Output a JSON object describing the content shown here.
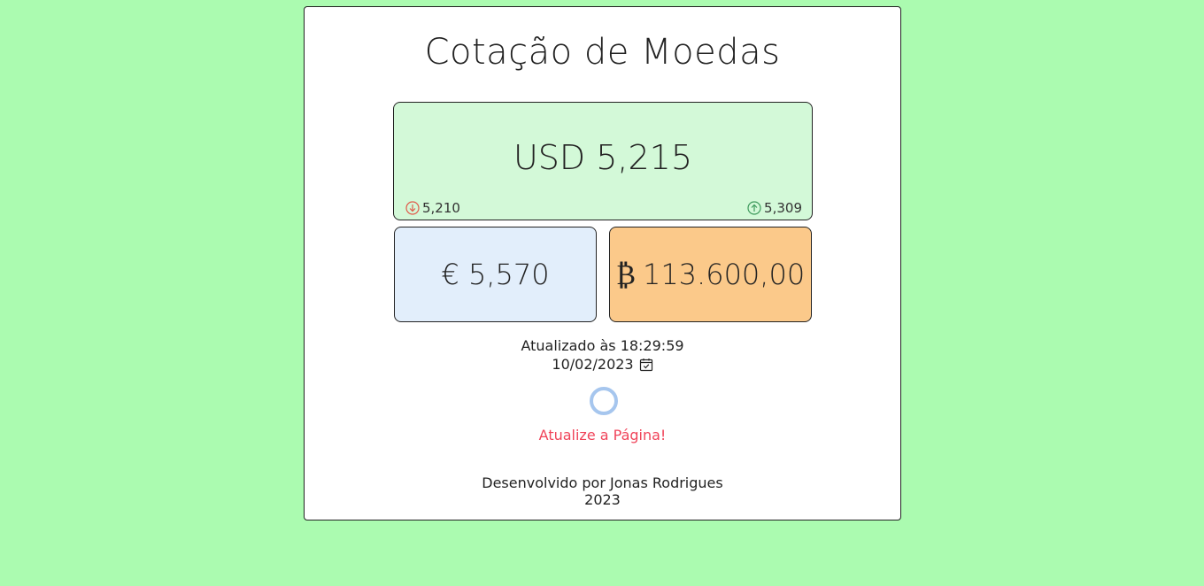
{
  "header": {
    "title": "Cotação de Moedas"
  },
  "usd": {
    "value_text": "USD 5,215",
    "low": "5,210",
    "high": "5,309",
    "low_icon": "arrow-down-circle-icon",
    "high_icon": "arrow-up-circle-icon"
  },
  "eur": {
    "value_text": "€ 5,570"
  },
  "btc": {
    "symbol": "₿",
    "value_text": "113.600,00"
  },
  "status": {
    "updated_text": "Atualizado às 18:29:59",
    "date_text": "10/02/2023",
    "date_icon": "calendar-check-icon",
    "refresh_text": "Atualize a Página!"
  },
  "footer": {
    "credit": "Desenvolvido por Jonas Rodrigues",
    "year": "2023"
  },
  "colors": {
    "background": "#abfbb0",
    "usd_box": "#d3f9d8",
    "eur_box": "#e2eefb",
    "btc_box": "#fbc98a",
    "low_arrow": "#e05a4a",
    "high_arrow": "#3e9a5c",
    "refresh_text": "#f0445a",
    "spinner": "#a6c6ee"
  }
}
